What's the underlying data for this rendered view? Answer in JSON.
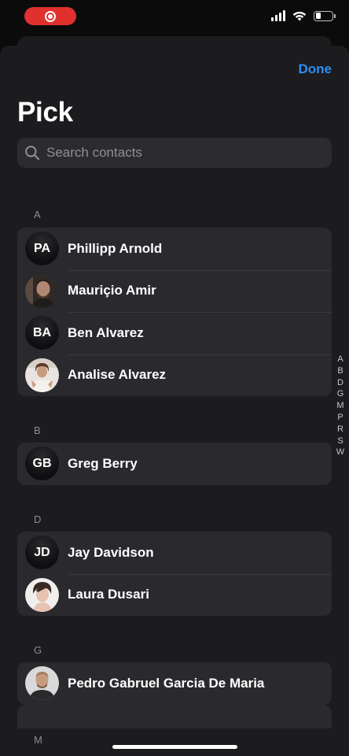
{
  "status_bar": {
    "signal_icon": "cellular-signal-icon",
    "wifi_icon": "wifi-icon",
    "battery_icon": "battery-icon",
    "recording_color": "#e0312f"
  },
  "header": {
    "done_label": "Done",
    "title": "Pick"
  },
  "search": {
    "placeholder": "Search contacts",
    "value": ""
  },
  "accent_color": "#2d8ef3",
  "sections": [
    {
      "letter": "A",
      "contacts": [
        {
          "name": "Phillipp Arnold",
          "initials": "PA",
          "photo": false
        },
        {
          "name": "Mauriçio Amir",
          "initials": "",
          "photo": true
        },
        {
          "name": "Ben Alvarez",
          "initials": "BA",
          "photo": false
        },
        {
          "name": "Analise Alvarez",
          "initials": "",
          "photo": true
        }
      ]
    },
    {
      "letter": "B",
      "contacts": [
        {
          "name": "Greg Berry",
          "initials": "GB",
          "photo": false
        }
      ]
    },
    {
      "letter": "D",
      "contacts": [
        {
          "name": "Jay Davidson",
          "initials": "JD",
          "photo": false
        },
        {
          "name": "Laura Dusari",
          "initials": "",
          "photo": true
        }
      ]
    },
    {
      "letter": "G",
      "contacts": [
        {
          "name": "Pedro Gabruel Garcia De Maria",
          "initials": "",
          "photo": true
        }
      ]
    },
    {
      "letter": "M",
      "contacts": []
    }
  ],
  "index_letters": [
    "A",
    "B",
    "D",
    "G",
    "M",
    "P",
    "R",
    "S",
    "W"
  ]
}
